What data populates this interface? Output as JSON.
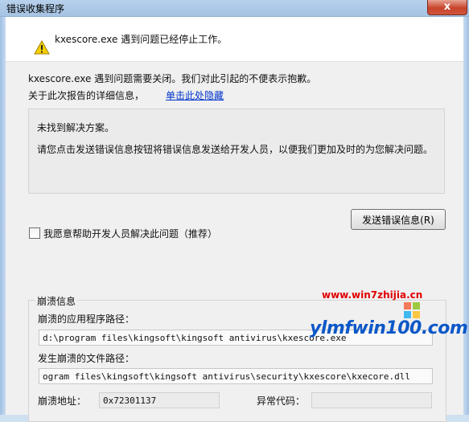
{
  "window": {
    "title": "错误收集程序",
    "close_label": "x"
  },
  "header": {
    "message": "kxescore.exe 遇到问题已经停止工作。"
  },
  "body": {
    "description": "kxescore.exe 遇到问题需要关闭。我们对此引起的不便表示抱歉。",
    "details_label": "关于此次报告的详细信息，",
    "details_link": "单击此处隐藏"
  },
  "solution": {
    "title": "未找到解决方案。",
    "text": "请您点击发送错误信息按钮将错误信息发送给开发人员，以便我们更加及时的为您解决问题。"
  },
  "actions": {
    "send_button": "发送错误信息(R)",
    "help_checkbox_label": "我愿意帮助开发人员解决此问题（推荐）"
  },
  "crash_info": {
    "group_title": "崩溃信息",
    "app_path_label": "崩溃的应用程序路径：",
    "app_path_value": "d:\\program files\\kingsoft\\kingsoft antivirus\\kxescore.exe",
    "file_path_label": "发生崩溃的文件路径：",
    "file_path_value": "ogram files\\kingsoft\\kingsoft antivirus\\security\\kxescore\\kxecore.dll",
    "address_label": "崩溃地址：",
    "address_value": "0x72301137",
    "exception_label": "异常代码："
  },
  "watermark": {
    "url": "www.win7zhijia.cn",
    "site": "ylmfwin100.com"
  },
  "colors": {
    "title_bar": "#a6c3e3",
    "link": "#0033cc",
    "watermark_red": "#e00000",
    "watermark_blue": "#0b57c8"
  }
}
